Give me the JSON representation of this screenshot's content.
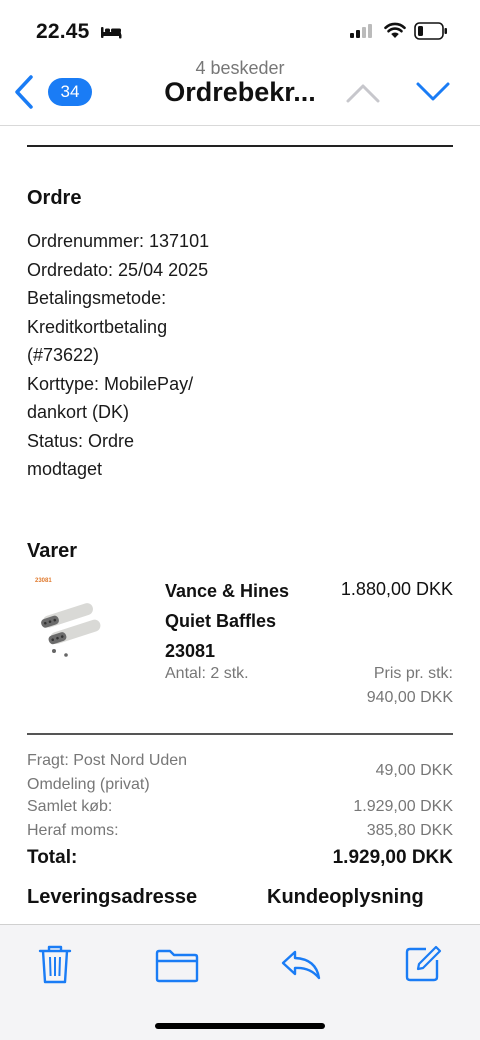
{
  "status_bar": {
    "time": "22.45",
    "icons": [
      "bed-icon",
      "signal-icon",
      "wifi-icon",
      "battery-icon"
    ]
  },
  "nav": {
    "back_count": "34",
    "subtitle": "4 beskeder",
    "title": "Ordrebekr...",
    "icons": [
      "chevron-left-icon",
      "chevron-up-icon",
      "chevron-down-icon"
    ]
  },
  "order": {
    "heading": "Ordre",
    "lines": [
      "Ordrenummer: 137101",
      "Ordredato: 25/04 2025",
      "Betalingsmetode:",
      "Kreditkortbetaling",
      "(#73622)",
      "Korttype: MobilePay/",
      "dankort (DK)",
      "Status: Ordre",
      "modtaget"
    ]
  },
  "items": {
    "heading": "Varer",
    "product": {
      "image_label": "23081",
      "name_lines": [
        "Vance & Hines",
        "Quiet Baffles",
        "23081"
      ],
      "price": "1.880,00 DKK",
      "quantity": "Antal: 2 stk.",
      "unit_price_label": "Pris pr. stk:",
      "unit_price": "940,00 DKK"
    }
  },
  "summary": {
    "shipping_label_lines": [
      "Fragt: Post Nord Uden",
      "Omdeling (privat)"
    ],
    "shipping_value": "49,00 DKK",
    "subtotal_label": "Samlet køb:",
    "subtotal_value": "1.929,00 DKK",
    "vat_label": "Heraf moms:",
    "vat_value": "385,80 DKK",
    "total_label": "Total:",
    "total_value": "1.929,00 DKK"
  },
  "address": {
    "delivery_heading": "Leveringsadresse",
    "customer_heading": "Kundeoplysning"
  },
  "toolbar": {
    "icons": [
      "trash-icon",
      "folder-icon",
      "reply-icon",
      "compose-icon"
    ]
  },
  "colors": {
    "accent": "#1a7cf5",
    "muted_text": "#777777",
    "toolbar_bg": "#f4f4f6"
  }
}
